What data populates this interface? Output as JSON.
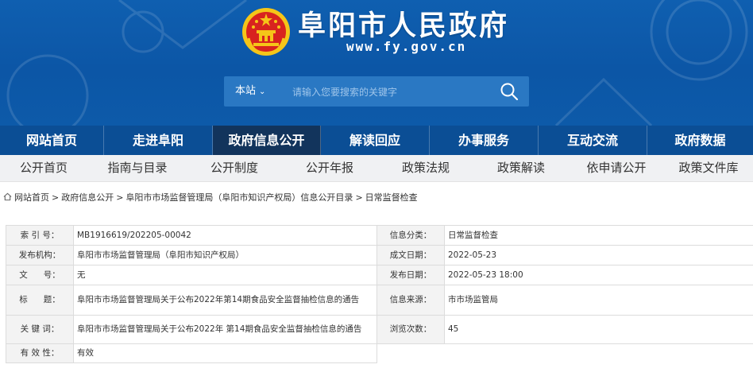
{
  "header": {
    "site_title": "阜阳市人民政府",
    "site_url": "www.fy.gov.cn",
    "search": {
      "scope_label": "本站",
      "placeholder": "请输入您要搜索的关键字"
    }
  },
  "main_nav": {
    "items": [
      {
        "label": "网站首页"
      },
      {
        "label": "走进阜阳"
      },
      {
        "label": "政府信息公开",
        "active": true
      },
      {
        "label": "解读回应"
      },
      {
        "label": "办事服务"
      },
      {
        "label": "互动交流"
      },
      {
        "label": "政府数据"
      }
    ]
  },
  "sub_nav": {
    "items": [
      {
        "label": "公开首页"
      },
      {
        "label": "指南与目录"
      },
      {
        "label": "公开制度"
      },
      {
        "label": "公开年报"
      },
      {
        "label": "政策法规"
      },
      {
        "label": "政策解读"
      },
      {
        "label": "依申请公开"
      },
      {
        "label": "政策文件库"
      }
    ]
  },
  "breadcrumb": {
    "items": [
      "网站首页",
      "政府信息公开",
      "阜阳市市场监督管理局（阜阳市知识产权局）信息公开目录",
      "日常监督检查"
    ],
    "separator": ">"
  },
  "info_table": {
    "index_label": "索 引 号：",
    "index_value": "MB1916619/202205-00042",
    "category_label": "信息分类：",
    "category_value": "日常监督检查",
    "publisher_label": "发布机构：",
    "publisher_value": "阜阳市市场监督管理局（阜阳市知识产权局）",
    "created_label": "成文日期：",
    "created_value": "2022-05-23",
    "docno_label": "文      号：",
    "docno_value": "无",
    "published_label": "发布日期：",
    "published_value": "2022-05-23 18:00",
    "title_label": "标      题：",
    "title_value": "阜阳市市场监督管理局关于公布2022年第14期食品安全监督抽检信息的通告",
    "source_label": "信息来源：",
    "source_value": "市市场监管局",
    "keywords_label": "关 键 词：",
    "keywords_value": "阜阳市市场监督管理局关于公布2022年 第14期食品安全监督抽检信息的通告",
    "views_label": "浏览次数：",
    "views_value": "45",
    "validity_label": "有 效 性：",
    "validity_value": "有效"
  },
  "colors": {
    "header_blue": "#0f5fb0",
    "nav_blue": "#0b4e95",
    "nav_active": "#12345c",
    "subnav_bg": "#f0f1f3"
  }
}
